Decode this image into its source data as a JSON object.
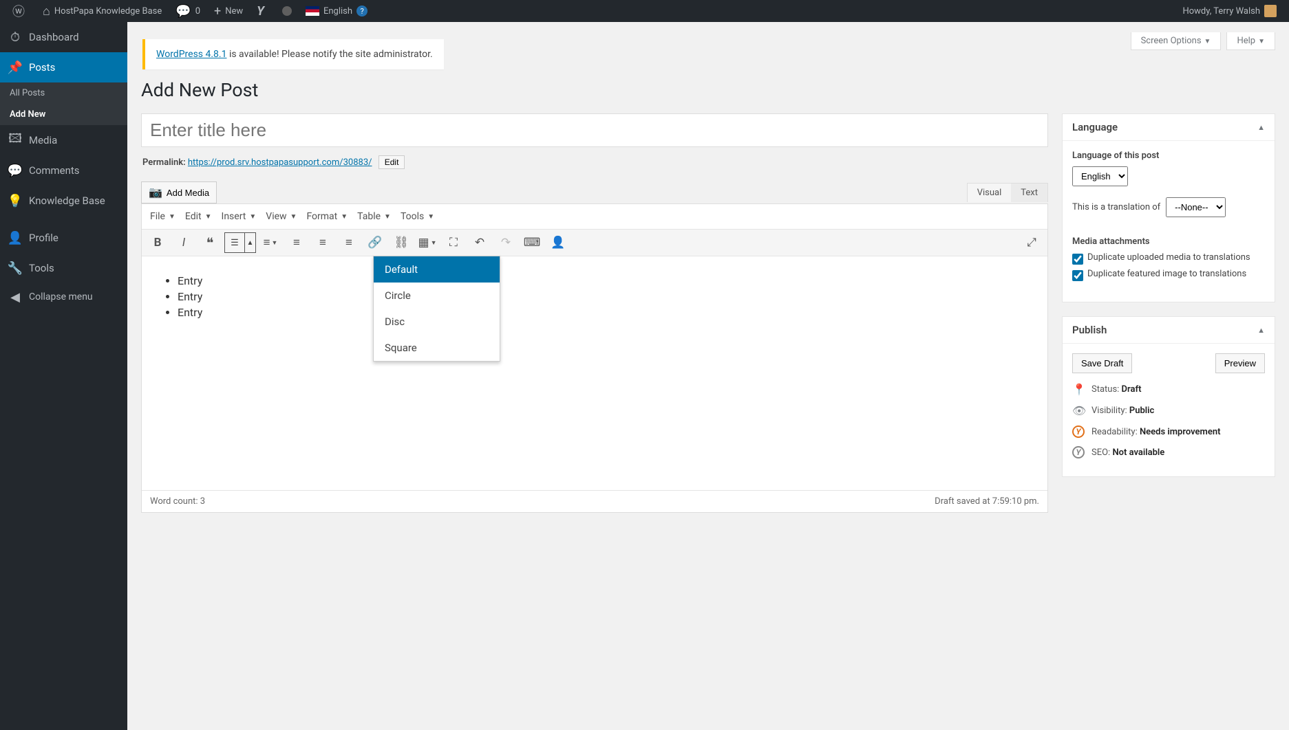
{
  "adminbar": {
    "site_name": "HostPapa Knowledge Base",
    "comments_count": "0",
    "new_label": "New",
    "language": "English",
    "howdy": "Howdy, Terry Walsh"
  },
  "sidebar": {
    "dashboard": "Dashboard",
    "posts": "Posts",
    "all_posts": "All Posts",
    "add_new": "Add New",
    "media": "Media",
    "comments": "Comments",
    "kb": "Knowledge Base",
    "profile": "Profile",
    "tools": "Tools",
    "collapse": "Collapse menu"
  },
  "screen_tabs": {
    "options": "Screen Options",
    "help": "Help"
  },
  "update_nag": {
    "link": "WordPress 4.8.1",
    "text": " is available! Please notify the site administrator."
  },
  "page_title": "Add New Post",
  "title_placeholder": "Enter title here",
  "permalink": {
    "label": "Permalink:",
    "url_prefix": "https://prod.srv.hostpapasupport.com/",
    "url_id": "30883/",
    "edit": "Edit"
  },
  "addmedia": "Add Media",
  "editor_tabs": {
    "visual": "Visual",
    "text": "Text"
  },
  "mce_menus": [
    "File",
    "Edit",
    "Insert",
    "View",
    "Format",
    "Table",
    "Tools"
  ],
  "bullet_dropdown": [
    "Default",
    "Circle",
    "Disc",
    "Square"
  ],
  "content_items": [
    "Entry",
    "Entry",
    "Entry"
  ],
  "statusbar": {
    "wc_label": "Word count: ",
    "wc_value": "3",
    "saved": "Draft saved at 7:59:10 pm."
  },
  "lang_box": {
    "title": "Language",
    "lang_of_post": "Language of this post",
    "lang_value": "English",
    "translation_of": "This is a translation of",
    "translation_sel": "--None--",
    "media_attachments": "Media attachments",
    "dup_media": "Duplicate uploaded media to translations",
    "dup_featured": "Duplicate featured image to translations"
  },
  "publish": {
    "title": "Publish",
    "save_draft": "Save Draft",
    "preview": "Preview",
    "status_label": "Status: ",
    "status_val": "Draft",
    "visibility_label": "Visibility: ",
    "visibility_val": "Public",
    "readability_label": "Readability: ",
    "readability_val": "Needs improvement",
    "seo_label": "SEO: ",
    "seo_val": "Not available"
  }
}
